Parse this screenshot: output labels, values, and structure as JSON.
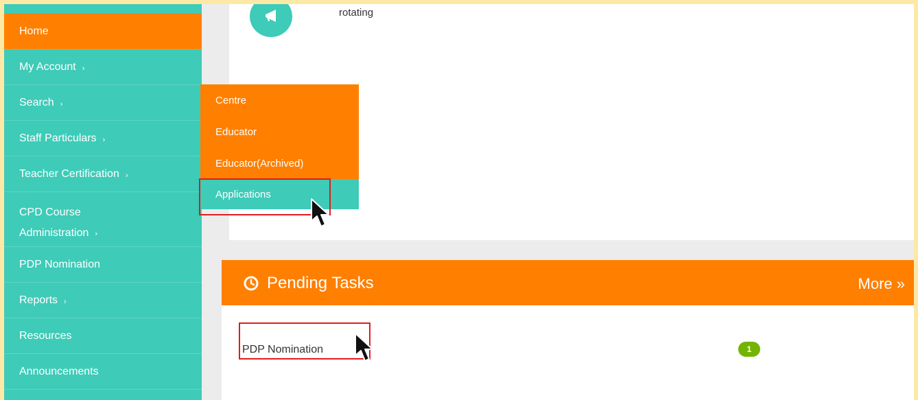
{
  "sidebar": {
    "items": [
      {
        "label": "Home",
        "chevron": false
      },
      {
        "label": "My Account",
        "chevron": true
      },
      {
        "label": "Search",
        "chevron": true
      },
      {
        "label": "Staff Particulars",
        "chevron": true
      },
      {
        "label": "Teacher Certification",
        "chevron": true
      },
      {
        "label": "CPD Course Administration",
        "chevron": true
      },
      {
        "label": "PDP Nomination",
        "chevron": false
      },
      {
        "label": "Reports",
        "chevron": true
      },
      {
        "label": "Resources",
        "chevron": false
      },
      {
        "label": "Announcements",
        "chevron": false
      }
    ],
    "chevron_glyph": "›"
  },
  "flyout": {
    "items": [
      "Centre",
      "Educator",
      "Educator(Archived)",
      "Applications"
    ]
  },
  "announcement": {
    "text": "rotating",
    "icon": "megaphone-icon"
  },
  "pending": {
    "title": "Pending Tasks",
    "more": "More »",
    "task_label": "PDP Nomination",
    "task_count": "1"
  },
  "colors": {
    "accent_orange": "#ff7f00",
    "teal": "#3ecbb8",
    "badge_green": "#73b400",
    "highlight_red": "#e01b1b",
    "outer_border": "#fde9a6"
  }
}
